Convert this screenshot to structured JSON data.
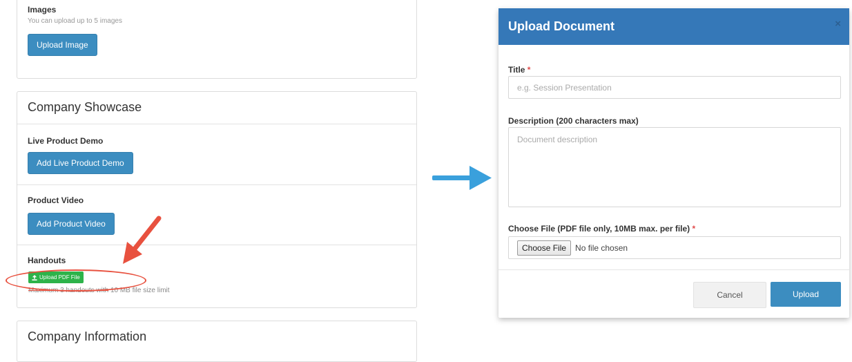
{
  "left": {
    "images": {
      "title": "Images",
      "hint": "You can upload up to 5 images",
      "upload_button": "Upload Image"
    },
    "showcase": {
      "title": "Company Showcase",
      "live_demo": {
        "label": "Live Product Demo",
        "button": "Add Live Product Demo"
      },
      "product_video": {
        "label": "Product Video",
        "button": "Add Product Video"
      },
      "handouts": {
        "label": "Handouts",
        "button": "Upload PDF File",
        "limit_strike": "Maximum 3 handouts with",
        "limit_rest": " 10 MB file size limit"
      }
    },
    "company_info": {
      "title": "Company Information"
    }
  },
  "modal": {
    "title": "Upload Document",
    "close": "×",
    "title_label": "Title",
    "title_placeholder": "e.g. Session Presentation",
    "description_label": "Description (200 characters max)",
    "description_placeholder": "Document description",
    "file_label": "Choose File (PDF file only, 10MB max. per file)",
    "required_mark": "*",
    "choose_button": "Choose File",
    "no_file": "No file chosen",
    "cancel": "Cancel",
    "upload": "Upload"
  },
  "colors": {
    "primary": "#3c8dc0",
    "header": "#3578b8",
    "success": "#2db34a",
    "annotation": "#e8513f",
    "arrow": "#3aa0dc"
  },
  "icons": [
    "upload-icon",
    "close-icon",
    "red-arrow-icon",
    "blue-arrow-icon"
  ]
}
